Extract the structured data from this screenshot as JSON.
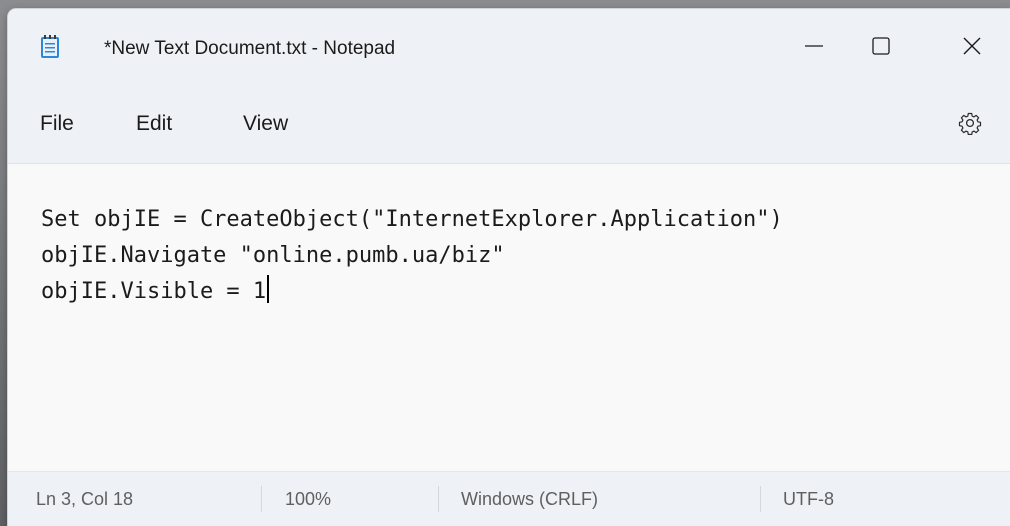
{
  "window": {
    "title": "*New Text Document.txt - Notepad"
  },
  "menu": {
    "file": "File",
    "edit": "Edit",
    "view": "View"
  },
  "editor": {
    "lines": [
      "Set objIE = CreateObject(\"InternetExplorer.Application\")",
      "objIE.Navigate \"online.pumb.ua/biz\"",
      "objIE.Visible = 1"
    ]
  },
  "status": {
    "position": "Ln 3, Col 18",
    "zoom": "100%",
    "line_ending": "Windows (CRLF)",
    "encoding": "UTF-8"
  },
  "colors": {
    "chrome": "#eef2f6",
    "editor_bg": "#f9f9f9",
    "text": "#1b1b1b",
    "status_text": "#5f5f5f"
  },
  "icons": {
    "app": "notepad-icon",
    "minimize": "minimize-icon",
    "maximize": "maximize-icon",
    "close": "close-icon",
    "settings": "gear-icon"
  }
}
